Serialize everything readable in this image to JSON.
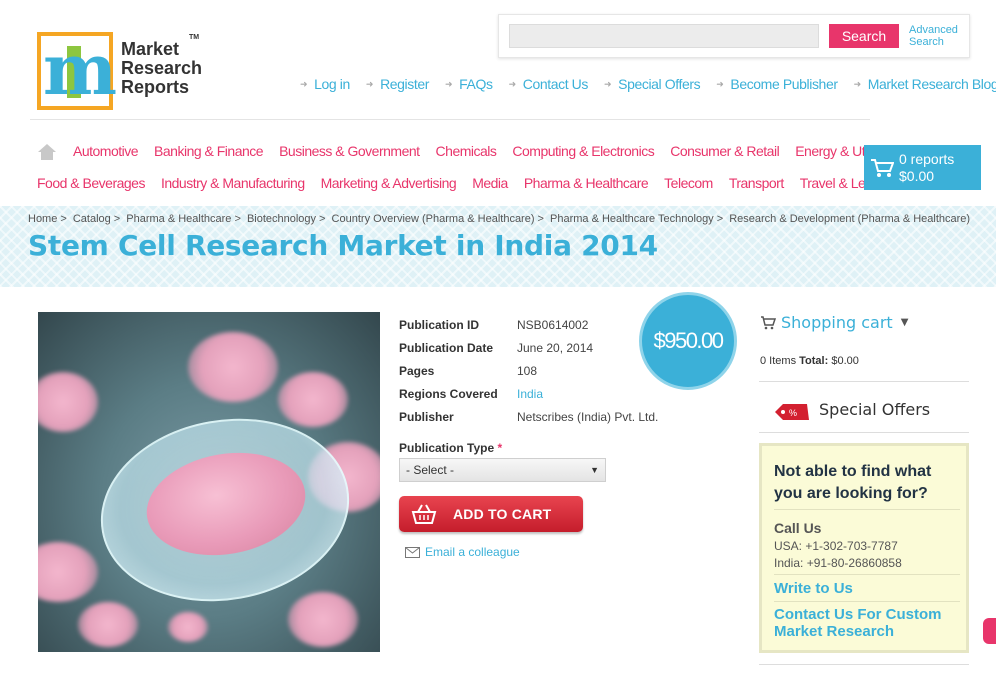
{
  "logo": {
    "line1": "Market",
    "line2": "Research",
    "line3": "Reports",
    "tm": "TM"
  },
  "search": {
    "placeholder": "",
    "button": "Search",
    "advanced_line1": "Advanced",
    "advanced_line2": "Search"
  },
  "topnav": [
    "Log in",
    "Register",
    "FAQs",
    "Contact Us",
    "Special Offers",
    "Become Publisher",
    "Market Research Blog"
  ],
  "categories_row1": [
    "Automotive",
    "Banking & Finance",
    "Business & Government",
    "Chemicals",
    "Computing & Electronics",
    "Consumer & Retail",
    "Energy & Utilities"
  ],
  "categories_row2": [
    "Food & Beverages",
    "Industry & Manufacturing",
    "Marketing & Advertising",
    "Media",
    "Pharma & Healthcare",
    "Telecom",
    "Transport",
    "Travel & Leisure"
  ],
  "cart": {
    "reports": "0 reports",
    "total": "$0.00"
  },
  "breadcrumb": [
    "Home",
    "Catalog",
    "Pharma & Healthcare",
    "Biotechnology",
    "Country Overview (Pharma & Healthcare)",
    "Pharma & Healthcare Technology",
    "Research & Development (Pharma & Healthcare)"
  ],
  "breadcrumb_sep": ">",
  "page_title": "Stem Cell Research Market in India 2014",
  "details": [
    {
      "label": "Publication ID",
      "value": "NSB0614002"
    },
    {
      "label": "Publication Date",
      "value": "June 20, 2014"
    },
    {
      "label": "Pages",
      "value": "108"
    },
    {
      "label": "Regions Covered",
      "value": "India"
    },
    {
      "label": "Publisher",
      "value": "Netscribes (India) Pvt. Ltd."
    }
  ],
  "price": "$950.00",
  "publication_type": {
    "label": "Publication Type",
    "required_mark": "*",
    "selected": "- Select -"
  },
  "add_to_cart": "ADD TO CART",
  "email_colleague": "Email a colleague",
  "sidebar": {
    "shopping_cart": "Shopping cart",
    "items": "0 Items",
    "total_label": "Total:",
    "total_value": "$0.00",
    "special_offers": "Special Offers",
    "help_title": "Not able to find what you are looking for?",
    "call_us": "Call Us",
    "phone_usa": "USA: +1-302-703-7787",
    "phone_india": "India: +91-80-26860858",
    "write_to_us": "Write to Us",
    "contact_custom": "Contact Us For Custom Market Research"
  },
  "colors": {
    "accent_blue": "#3bb0d8",
    "accent_pink": "#e8356b",
    "cart_red": "#c51d2c"
  }
}
